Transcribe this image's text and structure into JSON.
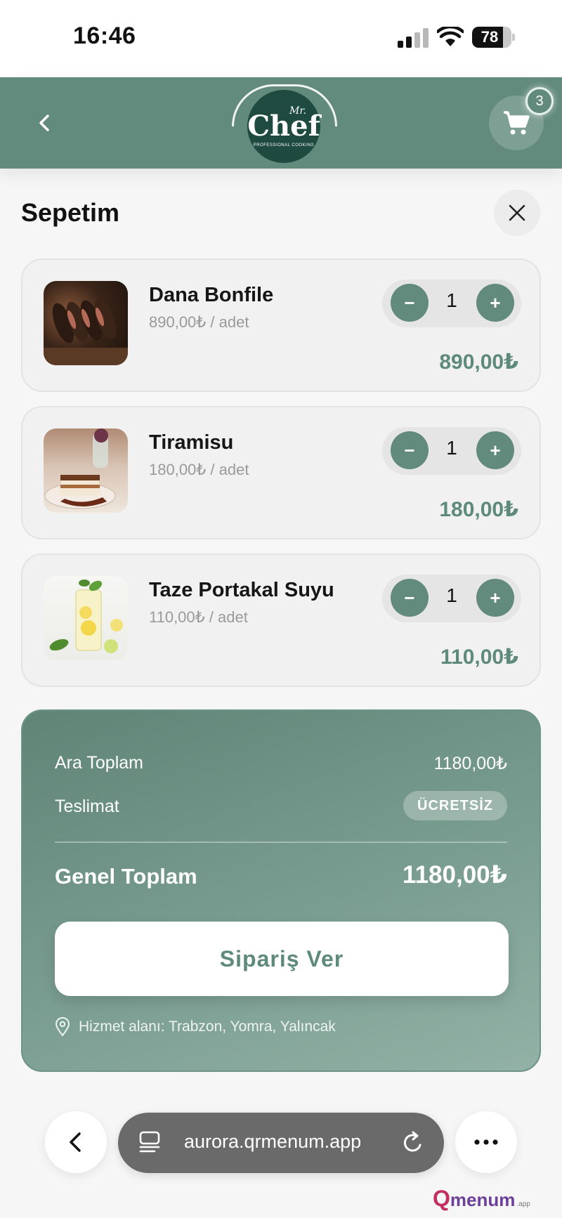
{
  "status": {
    "time": "16:46",
    "battery": "78"
  },
  "header": {
    "logo": {
      "mr": "Mr.",
      "name": "Chef",
      "tagline": "PROFESSIONAL COOKING"
    },
    "cart_count": "3"
  },
  "page_title": "Sepetim",
  "items": [
    {
      "name": "Dana Bonfile",
      "unit_price": "890,00₺ / adet",
      "qty": "1",
      "total": "890,00₺"
    },
    {
      "name": "Tiramisu",
      "unit_price": "180,00₺ / adet",
      "qty": "1",
      "total": "180,00₺"
    },
    {
      "name": "Taze Portakal Suyu",
      "unit_price": "110,00₺ / adet",
      "qty": "1",
      "total": "110,00₺"
    }
  ],
  "stepper": {
    "minus": "−",
    "plus": "+"
  },
  "summary": {
    "subtotal_label": "Ara Toplam",
    "subtotal_value": "1180,00₺",
    "delivery_label": "Teslimat",
    "delivery_value": "ÜCRETSİZ",
    "grand_label": "Genel Toplam",
    "grand_value": "1180,00₺",
    "order_button": "Sipariş Ver",
    "service_area": "Hizmet alanı: Trabzon, Yomra, Yalıncak"
  },
  "browser": {
    "url": "aurora.qrmenum.app"
  },
  "brand": {
    "q": "Q",
    "name": "menum",
    "suffix": ".app"
  },
  "colors": {
    "accent": "#628a7d",
    "accent_text": "#5e8a7b"
  }
}
